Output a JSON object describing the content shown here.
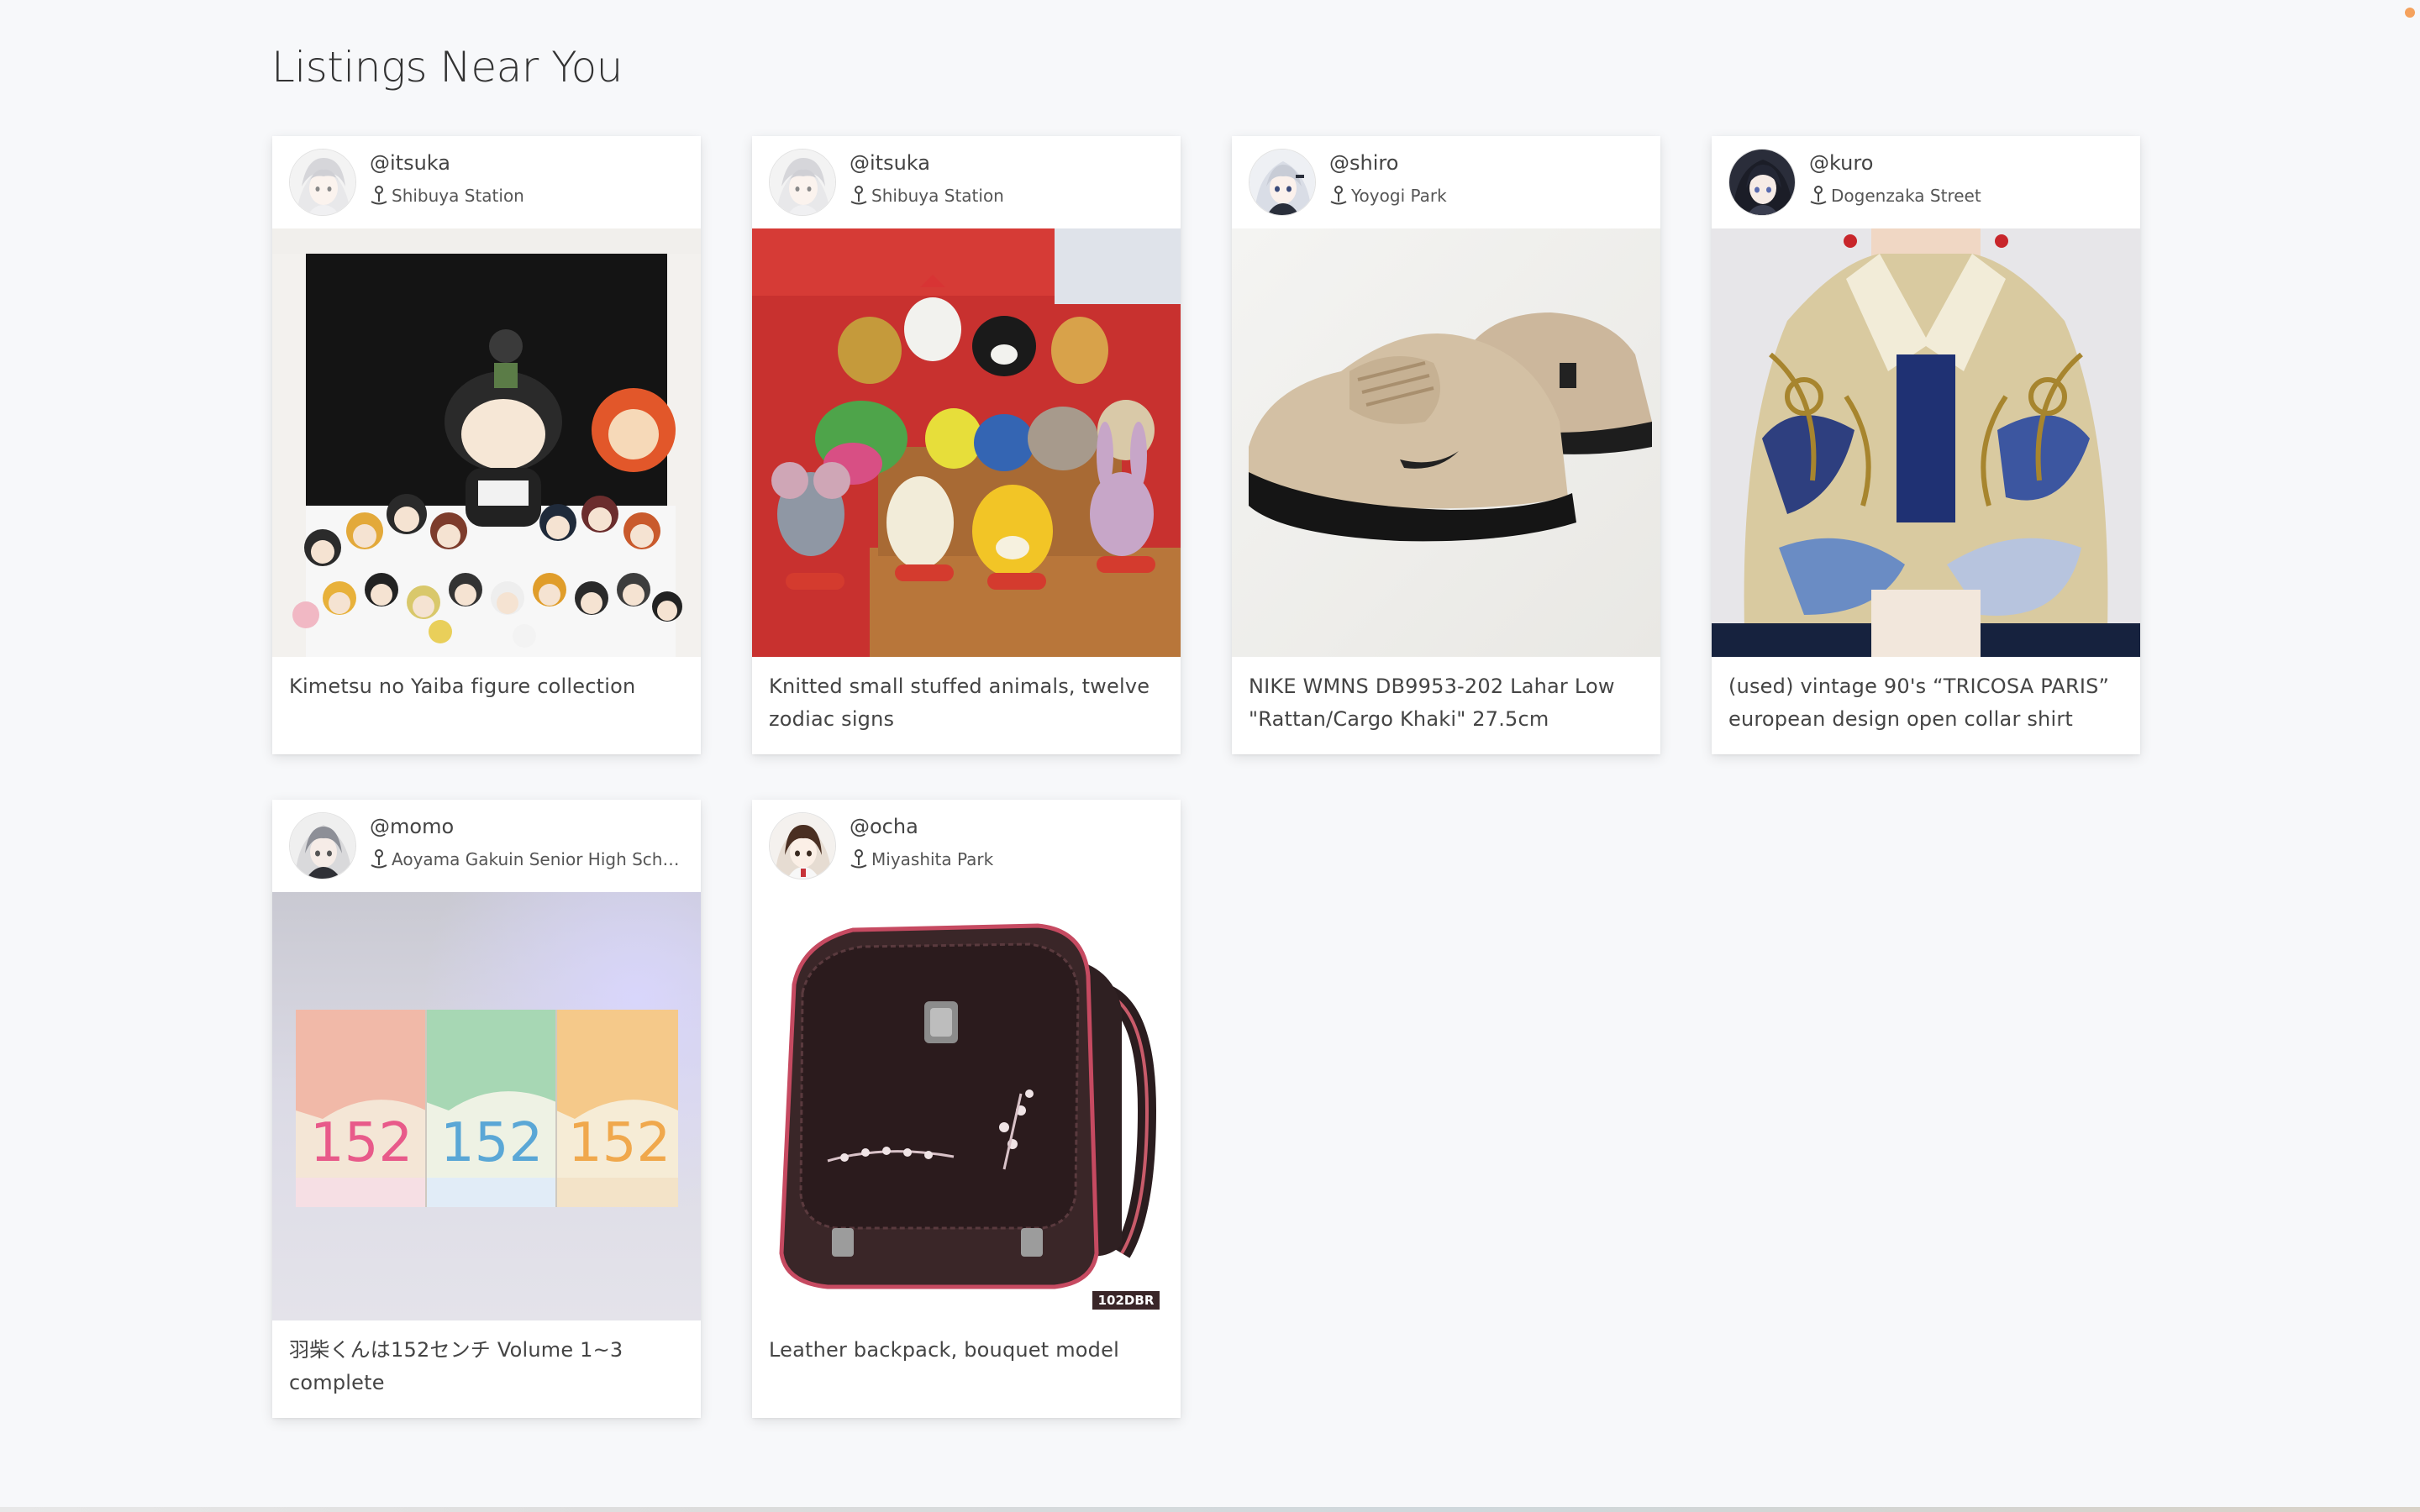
{
  "page": {
    "title": "Listings Near You"
  },
  "listings": [
    {
      "username": "@itsuka",
      "location": "Shibuya Station",
      "description": "Kimetsu no Yaiba figure collection",
      "avatar_icon": "anime-avatar-white-hair",
      "photo": "figure-collection-photo"
    },
    {
      "username": "@itsuka",
      "location": "Shibuya Station",
      "description": "Knitted small stuffed animals, twelve zodiac signs",
      "avatar_icon": "anime-avatar-white-hair",
      "photo": "knitted-animals-photo"
    },
    {
      "username": "@shiro",
      "location": "Yoyogi Park",
      "description": "NIKE WMNS DB9953-202 Lahar Low \"Rattan/Cargo Khaki\" 27.5cm",
      "avatar_icon": "anime-avatar-silver-hair",
      "photo": "sneakers-photo"
    },
    {
      "username": "@kuro",
      "location": "Dogenzaka Street",
      "description": "(used) vintage 90's “TRICOSA PARIS” european design open collar shirt",
      "avatar_icon": "anime-avatar-dark-hair",
      "photo": "vintage-shirt-photo"
    },
    {
      "username": "@momo",
      "location": "Aoyama Gakuin Senior High School",
      "description": "羽柴くんは152センチ Volume 1~3 complete",
      "avatar_icon": "anime-avatar-grey-hair",
      "photo": "manga-volumes-photo"
    },
    {
      "username": "@ocha",
      "location": "Miyashita Park",
      "description": "Leather backpack, bouquet model",
      "avatar_icon": "anime-avatar-brown-hair",
      "photo": "leather-backpack-photo",
      "photo_badge": "102DBR"
    }
  ],
  "colors": {
    "background": "#f7f8fa",
    "card": "#ffffff",
    "notification_dot": "#f5a25d"
  }
}
